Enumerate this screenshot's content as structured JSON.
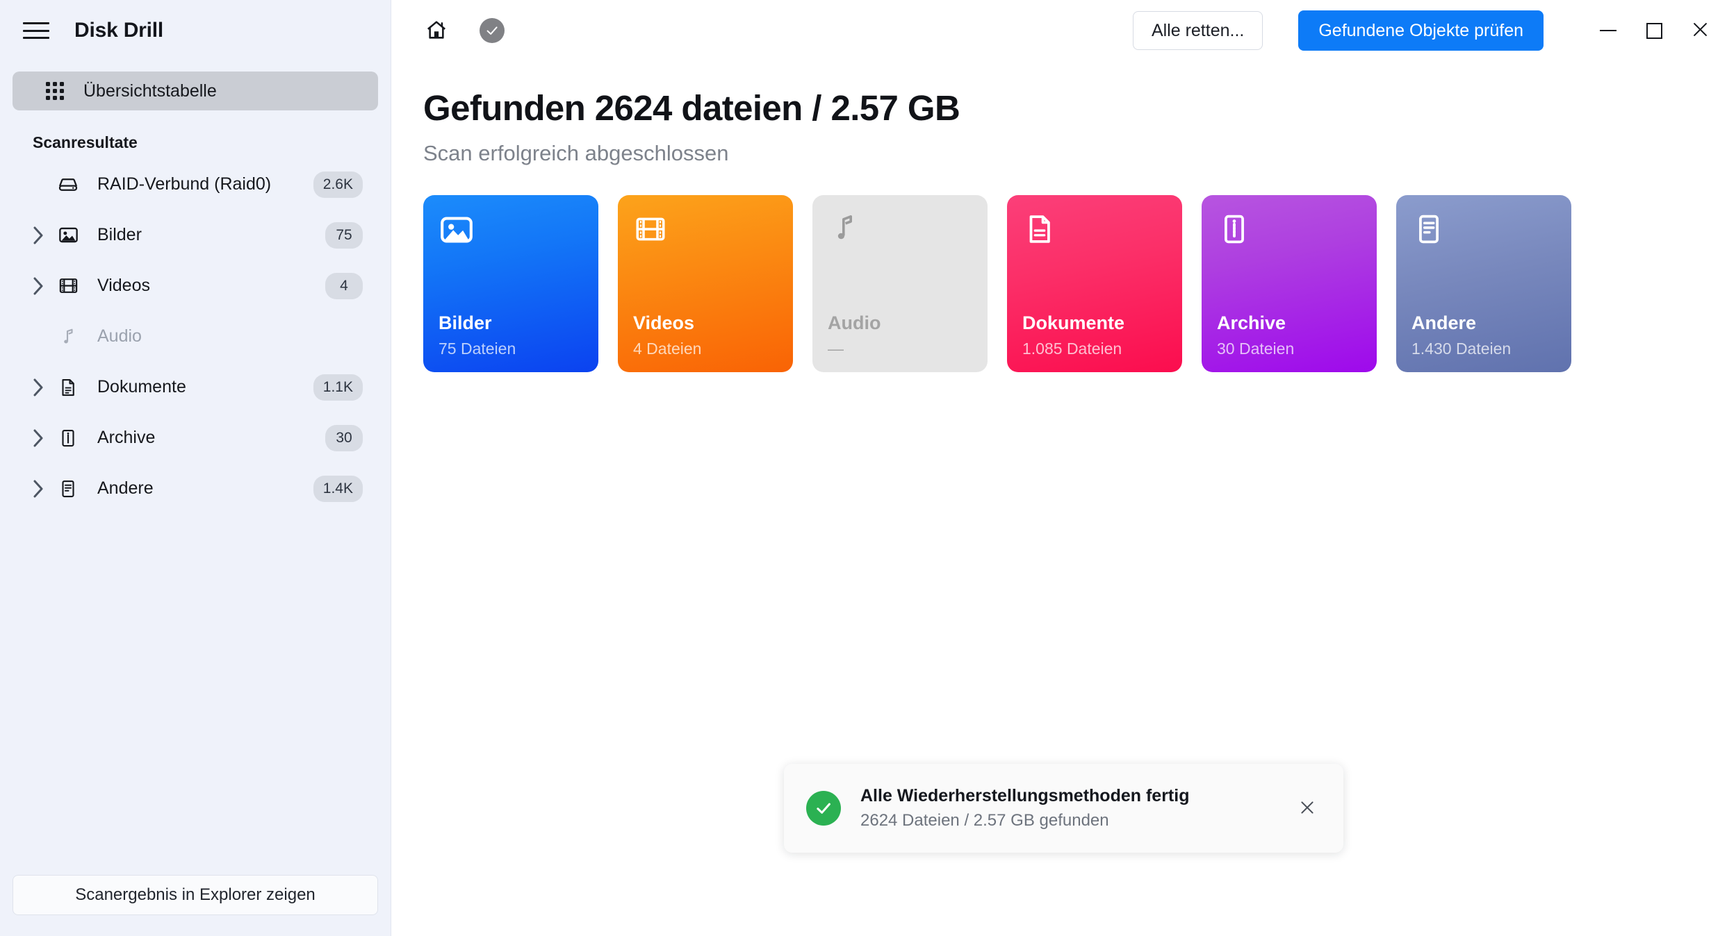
{
  "app": {
    "title": "Disk Drill"
  },
  "sidebar": {
    "menu_icon": "hamburger-icon",
    "overview": {
      "label": "Übersichtstabelle",
      "icon": "grid-icon"
    },
    "section_title": "Scanresultate",
    "items": [
      {
        "label": "RAID-Verbund (Raid0)",
        "badge": "2.6K",
        "icon": "drive-icon",
        "expandable": false,
        "disabled": false
      },
      {
        "label": "Bilder",
        "badge": "75",
        "icon": "image-icon",
        "expandable": true,
        "disabled": false
      },
      {
        "label": "Videos",
        "badge": "4",
        "icon": "film-icon",
        "expandable": true,
        "disabled": false
      },
      {
        "label": "Audio",
        "badge": "",
        "icon": "music-note-icon",
        "expandable": false,
        "disabled": true
      },
      {
        "label": "Dokumente",
        "badge": "1.1K",
        "icon": "document-icon",
        "expandable": true,
        "disabled": false
      },
      {
        "label": "Archive",
        "badge": "30",
        "icon": "archive-zip-icon",
        "expandable": true,
        "disabled": false
      },
      {
        "label": "Andere",
        "badge": "1.4K",
        "icon": "file-lines-icon",
        "expandable": true,
        "disabled": false
      }
    ],
    "footer_button": "Scanergebnis in Explorer zeigen"
  },
  "topbar": {
    "home_icon": "home-icon",
    "status_icon": "check-circle-icon",
    "secondary_button": "Alle retten...",
    "primary_button": "Gefundene Objekte prüfen",
    "window": {
      "minimize": "minimize-icon",
      "maximize": "maximize-icon",
      "close": "close-icon"
    }
  },
  "main": {
    "headline": "Gefunden 2624 dateien / 2.57 GB",
    "subhead": "Scan erfolgreich abgeschlossen",
    "cards": [
      {
        "name": "Bilder",
        "count": "75 Dateien",
        "icon": "image-icon",
        "class": "c-bilder",
        "color": "#0d7bf7"
      },
      {
        "name": "Videos",
        "count": "4 Dateien",
        "icon": "film-icon",
        "class": "c-videos",
        "color": "#f97f0a"
      },
      {
        "name": "Audio",
        "count": "—",
        "icon": "music-note-icon",
        "class": "c-audio",
        "color": "#e5e5e5"
      },
      {
        "name": "Dokumente",
        "count": "1.085 Dateien",
        "icon": "document-icon",
        "class": "c-dokumente",
        "color": "#fb2a62"
      },
      {
        "name": "Archive",
        "count": "30 Dateien",
        "icon": "archive-zip-icon",
        "class": "c-archive",
        "color": "#ab3ce3"
      },
      {
        "name": "Andere",
        "count": "1.430 Dateien",
        "icon": "file-lines-icon",
        "class": "c-andere",
        "color": "#7787bc"
      }
    ]
  },
  "toast": {
    "icon": "check-circle-icon",
    "title": "Alle Wiederherstellungsmethoden fertig",
    "subtitle": "2624 Dateien / 2.57 GB gefunden",
    "close_icon": "close-icon",
    "accent": "#2bb152"
  }
}
